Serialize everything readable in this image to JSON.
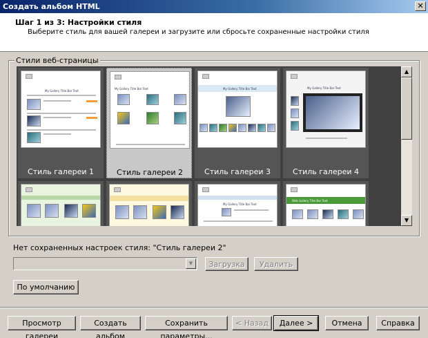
{
  "window": {
    "title": "Создать альбом HTML",
    "close_symbol": "✕"
  },
  "header": {
    "step_title": "Шаг 1 из 3: Настройки стиля",
    "step_desc": "Выберите стиль для вашей галереи и загрузите или сбросьте сохраненные настройки стиля"
  },
  "styles_group": {
    "legend": "Стили веб-страницы",
    "gallery": [
      {
        "caption": "Стиль галереи 1",
        "selected": false
      },
      {
        "caption": "Стиль галереи 2",
        "selected": true
      },
      {
        "caption": "Стиль галереи 3",
        "selected": false
      },
      {
        "caption": "Стиль галереи 4",
        "selected": false
      }
    ],
    "thumb_texts": {
      "t1_title": "My Gallery Title Bar Text",
      "t2_title": "My Gallery Title Bar Text",
      "t3_title": "My Gallery Title Bar Text",
      "t4_title": "My Gallery Title Bar Text",
      "t7_title": "My Gallery Title Bar Text",
      "t8_title": "Web Gallery Title Bar Text"
    }
  },
  "saved": {
    "label": "Нет сохраненных настроек стиля: \"Стиль галереи 2\"",
    "combo_value": "",
    "load_button": "Загрузка",
    "delete_button": "Удалить",
    "default_button": "По умолчанию"
  },
  "footer": {
    "preview_button": "Просмотр галереи",
    "create_button": "Создать альбом",
    "save_params_button": "Сохранить параметры...",
    "back_button": "< Назад",
    "next_button": "Далее >",
    "cancel_button": "Отмена",
    "help_button": "Справка"
  }
}
